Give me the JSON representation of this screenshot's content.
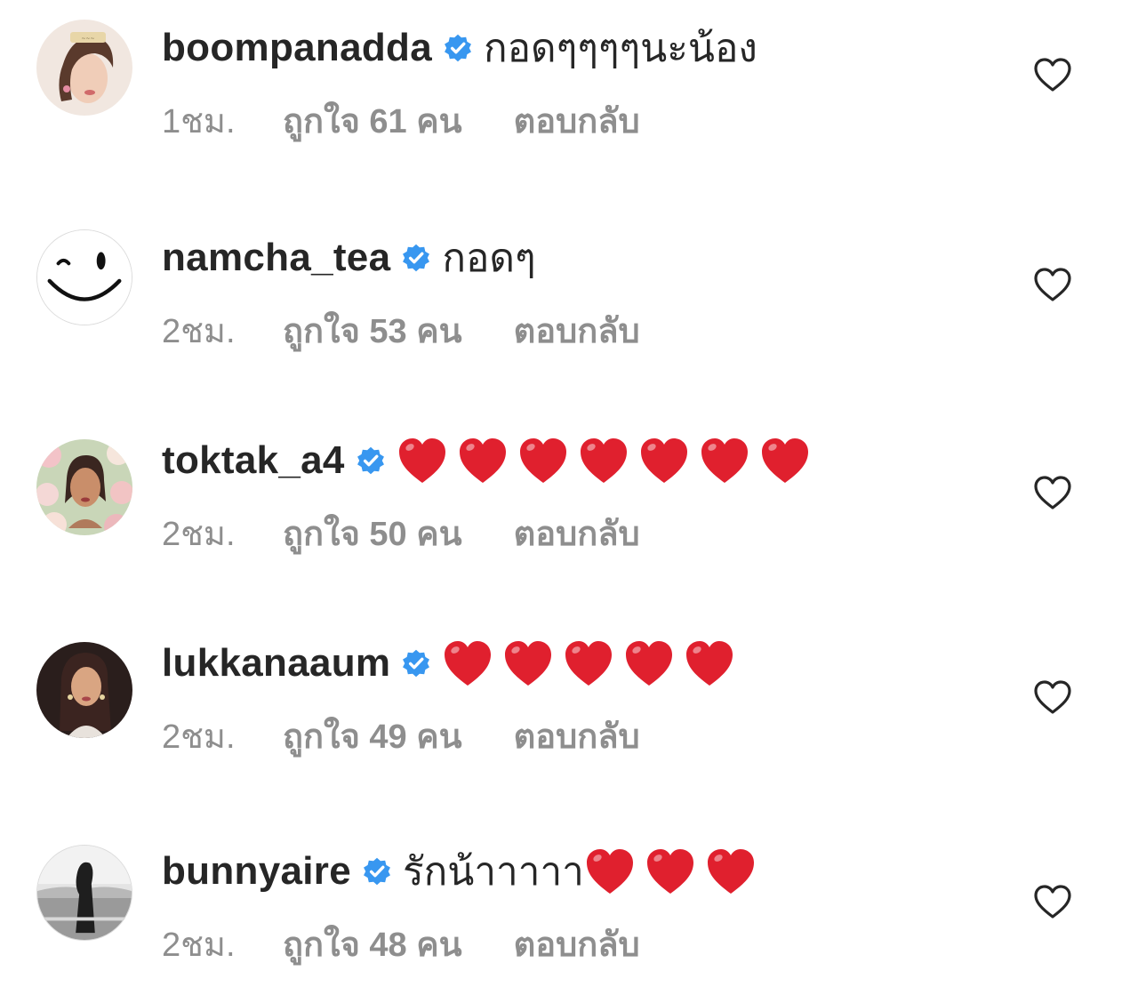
{
  "colors": {
    "text": "#262626",
    "meta": "#8e8e8e",
    "verified": "#3897f0",
    "heart_emoji": "#e0202e"
  },
  "comments": [
    {
      "username": "boompanadda",
      "verified": true,
      "text": "กอดๆๆๆๆนะน้อง",
      "heart_emoji_count": 0,
      "time": "1ชม.",
      "likes": "ถูกใจ 61 คน",
      "reply": "ตอบกลับ",
      "avatar": "avatar-boompanadda",
      "like_icon": "heart-outline-icon"
    },
    {
      "username": "namcha_tea",
      "verified": true,
      "text": "กอดๆ",
      "heart_emoji_count": 0,
      "time": "2ชม.",
      "likes": "ถูกใจ 53 คน",
      "reply": "ตอบกลับ",
      "avatar": "avatar-smiley",
      "like_icon": "heart-outline-icon"
    },
    {
      "username": "toktak_a4",
      "verified": true,
      "text": "",
      "heart_emoji_count": 7,
      "time": "2ชม.",
      "likes": "ถูกใจ 50 คน",
      "reply": "ตอบกลับ",
      "avatar": "avatar-toktak",
      "like_icon": "heart-outline-icon"
    },
    {
      "username": "lukkanaaum",
      "verified": true,
      "text": "",
      "heart_emoji_count": 5,
      "time": "2ชม.",
      "likes": "ถูกใจ 49 คน",
      "reply": "ตอบกลับ",
      "avatar": "avatar-lukkanaaum",
      "like_icon": "heart-outline-icon"
    },
    {
      "username": "bunnyaire",
      "verified": true,
      "text": "รักน้าาาาา",
      "heart_emoji_count": 3,
      "time": "2ชม.",
      "likes": "ถูกใจ 48 คน",
      "reply": "ตอบกลับ",
      "avatar": "avatar-bunnyaire",
      "like_icon": "heart-outline-icon"
    }
  ]
}
